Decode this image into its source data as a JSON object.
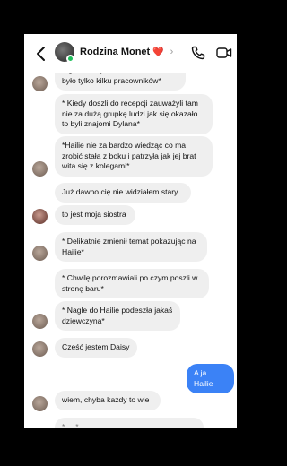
{
  "header": {
    "title": "Rodzina Monet",
    "title_emoji": "❤️",
    "chevron": "›",
    "icons": [
      "back-arrow-icon",
      "group-avatar",
      "phone-icon",
      "video-camera-icon"
    ]
  },
  "messages": [
    {
      "from": "them",
      "text": "tego dnia było bardzo mało osób było tylko kilku pracowników*"
    },
    {
      "from": "them",
      "text": "* Kiedy doszli do recepcji zauważyli tam nie za dużą grupkę ludzi jak się okazało to byli znajomi Dylana*"
    },
    {
      "from": "them",
      "text": "*Hailie nie za bardzo wiedząc co ma zrobić stała z boku i patrzyła jak jej brat wita się z kolegami*"
    },
    {
      "from": "them",
      "text": "Już dawno cię nie widziałem stary"
    },
    {
      "from": "them",
      "text": "to jest moja siostra"
    },
    {
      "from": "them",
      "text": "* Delikatnie zmienił temat pokazując na Hailie*"
    },
    {
      "from": "them",
      "text": "* Chwilę porozmawiali po czym poszli w stronę baru*"
    },
    {
      "from": "them",
      "text": "* Nagle do Hailie podeszła jakaś dziewczyna*"
    },
    {
      "from": "them",
      "text": "Cześć jestem Daisy"
    },
    {
      "from": "me",
      "text": "A ja Hailie"
    },
    {
      "from": "them",
      "text": "wiem, chyba każdy to wie"
    },
    {
      "from": "them",
      "text": "* ... *"
    }
  ],
  "colors": {
    "my_bubble": "#3b82f6",
    "their_bubble": "#efefef",
    "online_dot": "#1ec05b"
  }
}
